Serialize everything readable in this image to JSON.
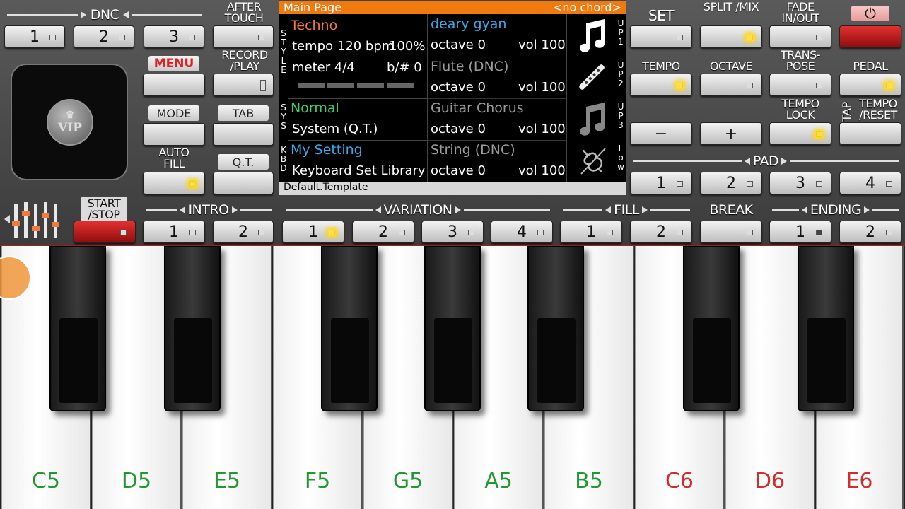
{
  "sections": {
    "dnc": "DNC",
    "intro": "INTRO",
    "variation": "VARIATION",
    "fill": "FILL",
    "break": "BREAK",
    "ending": "ENDING",
    "pad": "PAD"
  },
  "labels": {
    "after_touch": "AFTER TOUCH",
    "record_play": "RECORD /PLAY",
    "auto_fill": "AUTO FILL",
    "start_stop": "START /STOP",
    "set": "SET",
    "split_mix": "SPLIT /MIX",
    "fade_in_out": "FADE IN/OUT",
    "tempo": "TEMPO",
    "octave": "OCTAVE",
    "transpose": "TRANS- POSE",
    "pedal": "PEDAL",
    "tempo_lock": "TEMPO LOCK",
    "tap": "TAP",
    "tempo_reset": "TEMPO /RESET",
    "menu": "MENU",
    "mode": "MODE",
    "tab": "TAB",
    "qt": "Q.T.",
    "vip": "VIP",
    "minus": "−",
    "plus": "+",
    "power": "⏻"
  },
  "numbers": {
    "dnc": [
      "1",
      "2",
      "3"
    ],
    "intro": [
      "1",
      "2"
    ],
    "variation": [
      "1",
      "2",
      "3",
      "4"
    ],
    "fill": [
      "1",
      "2"
    ],
    "ending": [
      "1",
      "2"
    ],
    "pad": [
      "1",
      "2",
      "3",
      "4"
    ]
  },
  "screen": {
    "header_left": "Main Page",
    "header_right": "<no chord>",
    "footer": "Default.Template",
    "side_left": [
      "S\nT\nY\nL\nE",
      "S\nY\nS",
      "K\nB\nD"
    ],
    "side_right": [
      "U\nP\n1",
      "U\nP\n2",
      "U\nP\n3",
      "L\no\nw"
    ],
    "style_name": "Techno",
    "tempo_line": "tempo 120 bpm",
    "tempo_pct": "100%",
    "meter": "meter 4/4",
    "key": "b/#  0",
    "sys_name": "Normal",
    "sys_sub": "System (Q.T.)",
    "kbd_name": "My Setting",
    "kbd_sub": "Keyboard Set Library",
    "tracks": [
      {
        "name": "deary gyan",
        "octave": "octave  0",
        "vol": "vol 100"
      },
      {
        "name": "Flute (DNC)",
        "octave": "octave  0",
        "vol": "vol 100"
      },
      {
        "name": "Guitar Chorus",
        "octave": "octave  0",
        "vol": "vol 100"
      },
      {
        "name": "String (DNC)",
        "octave": "octave  0",
        "vol": "vol 100"
      }
    ]
  },
  "keys": {
    "white": [
      "C5",
      "D5",
      "E5",
      "F5",
      "G5",
      "A5",
      "B5",
      "C6",
      "D6",
      "E6"
    ],
    "white_colors": [
      "#1e9a2e",
      "#1e9a2e",
      "#1e9a2e",
      "#1e9a2e",
      "#1e9a2e",
      "#1e9a2e",
      "#1e9a2e",
      "#d62b2b",
      "#d62b2b",
      "#d62b2b"
    ]
  },
  "colors": {
    "accent": "#ee7a10",
    "led_on": "#ffd200",
    "start_stop": "#c01818"
  }
}
